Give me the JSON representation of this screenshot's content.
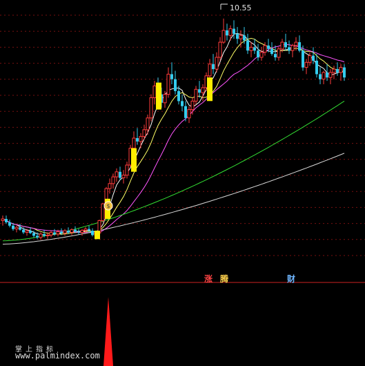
{
  "chart_data": {
    "type": "candlestick",
    "ylim": [
      3.0,
      11.0
    ],
    "peak_label": "10.55",
    "candles": [
      [
        4.55,
        4.7,
        4.4,
        4.6
      ],
      [
        4.6,
        4.7,
        4.45,
        4.5
      ],
      [
        4.5,
        4.58,
        4.35,
        4.4
      ],
      [
        4.4,
        4.48,
        4.25,
        4.3
      ],
      [
        4.3,
        4.4,
        4.2,
        4.35
      ],
      [
        4.35,
        4.45,
        4.25,
        4.28
      ],
      [
        4.28,
        4.35,
        4.15,
        4.2
      ],
      [
        4.2,
        4.3,
        4.1,
        4.25
      ],
      [
        4.25,
        4.35,
        4.15,
        4.18
      ],
      [
        4.18,
        4.25,
        4.05,
        4.1
      ],
      [
        4.1,
        4.2,
        4.0,
        4.05
      ],
      [
        4.05,
        4.2,
        3.98,
        4.15
      ],
      [
        4.15,
        4.28,
        4.05,
        4.1
      ],
      [
        4.1,
        4.2,
        4.0,
        4.12
      ],
      [
        4.12,
        4.25,
        4.05,
        4.2
      ],
      [
        4.2,
        4.3,
        4.1,
        4.15
      ],
      [
        4.15,
        4.28,
        4.08,
        4.22
      ],
      [
        4.22,
        4.32,
        4.12,
        4.18
      ],
      [
        4.18,
        4.3,
        4.1,
        4.25
      ],
      [
        4.25,
        4.35,
        4.15,
        4.2
      ],
      [
        4.2,
        4.32,
        4.12,
        4.28
      ],
      [
        4.28,
        4.38,
        4.18,
        4.22
      ],
      [
        4.22,
        4.3,
        4.14,
        4.2
      ],
      [
        4.2,
        4.3,
        4.1,
        4.26
      ],
      [
        4.26,
        4.36,
        4.18,
        4.3
      ],
      [
        4.3,
        4.4,
        4.2,
        4.25
      ],
      [
        4.25,
        4.32,
        4.08,
        4.12
      ],
      [
        4.12,
        4.22,
        4.02,
        4.18
      ],
      [
        4.18,
        4.58,
        4.12,
        4.55
      ],
      [
        4.55,
        5.08,
        4.5,
        5.05
      ],
      [
        5.05,
        5.55,
        5.0,
        5.5
      ],
      [
        5.5,
        5.8,
        5.35,
        5.65
      ],
      [
        5.65,
        5.95,
        5.5,
        5.85
      ],
      [
        5.85,
        6.1,
        5.7,
        6.0
      ],
      [
        6.0,
        6.15,
        5.75,
        5.82
      ],
      [
        5.82,
        6.05,
        5.65,
        5.9
      ],
      [
        5.9,
        6.3,
        5.8,
        6.2
      ],
      [
        6.2,
        6.8,
        6.15,
        6.7
      ],
      [
        6.7,
        7.2,
        6.55,
        7.0
      ],
      [
        7.0,
        7.3,
        6.8,
        6.9
      ],
      [
        6.9,
        7.15,
        6.7,
        7.05
      ],
      [
        7.05,
        7.4,
        6.95,
        7.25
      ],
      [
        7.25,
        7.7,
        7.1,
        7.6
      ],
      [
        7.6,
        8.3,
        7.5,
        8.2
      ],
      [
        8.2,
        8.7,
        8.0,
        8.55
      ],
      [
        8.55,
        8.8,
        8.2,
        8.3
      ],
      [
        8.3,
        8.5,
        7.9,
        8.05
      ],
      [
        8.05,
        8.4,
        7.9,
        8.3
      ],
      [
        8.3,
        9.1,
        8.2,
        8.9
      ],
      [
        8.9,
        9.25,
        8.6,
        8.75
      ],
      [
        8.75,
        9.0,
        8.3,
        8.4
      ],
      [
        8.4,
        8.55,
        8.0,
        8.1
      ],
      [
        8.1,
        8.3,
        7.8,
        7.95
      ],
      [
        7.95,
        8.1,
        7.5,
        7.6
      ],
      [
        7.6,
        7.95,
        7.45,
        7.85
      ],
      [
        7.85,
        8.2,
        7.7,
        8.1
      ],
      [
        8.1,
        8.55,
        8.0,
        8.45
      ],
      [
        8.45,
        8.7,
        8.2,
        8.35
      ],
      [
        8.35,
        8.6,
        8.1,
        8.5
      ],
      [
        8.5,
        8.95,
        8.4,
        8.85
      ],
      [
        8.85,
        9.35,
        8.7,
        9.2
      ],
      [
        9.2,
        9.5,
        8.9,
        9.05
      ],
      [
        9.05,
        9.55,
        8.95,
        9.4
      ],
      [
        9.4,
        10.0,
        9.3,
        9.85
      ],
      [
        9.85,
        10.55,
        9.8,
        10.2
      ],
      [
        10.2,
        10.4,
        9.9,
        10.05
      ],
      [
        10.05,
        10.35,
        9.9,
        10.25
      ],
      [
        10.25,
        10.5,
        9.95,
        10.1
      ],
      [
        10.1,
        10.3,
        9.8,
        9.95
      ],
      [
        9.95,
        10.2,
        9.7,
        10.05
      ],
      [
        10.05,
        10.3,
        9.8,
        9.9
      ],
      [
        9.9,
        10.1,
        9.5,
        9.6
      ],
      [
        9.6,
        9.85,
        9.4,
        9.7
      ],
      [
        9.7,
        9.95,
        9.5,
        9.6
      ],
      [
        9.6,
        9.8,
        9.3,
        9.4
      ],
      [
        9.4,
        9.7,
        9.3,
        9.55
      ],
      [
        9.55,
        9.85,
        9.45,
        9.75
      ],
      [
        9.75,
        9.95,
        9.55,
        9.65
      ],
      [
        9.65,
        9.85,
        9.45,
        9.5
      ],
      [
        9.5,
        9.75,
        9.3,
        9.4
      ],
      [
        9.4,
        9.7,
        9.3,
        9.65
      ],
      [
        9.65,
        9.95,
        9.55,
        9.85
      ],
      [
        9.85,
        10.1,
        9.6,
        9.7
      ],
      [
        9.7,
        9.9,
        9.5,
        9.6
      ],
      [
        9.6,
        9.8,
        9.4,
        9.75
      ],
      [
        9.75,
        10.0,
        9.6,
        9.85
      ],
      [
        9.85,
        10.05,
        9.55,
        9.6
      ],
      [
        9.6,
        9.75,
        9.0,
        9.1
      ],
      [
        9.1,
        9.35,
        8.9,
        9.25
      ],
      [
        9.25,
        9.55,
        9.15,
        9.45
      ],
      [
        9.45,
        9.7,
        9.2,
        9.3
      ],
      [
        9.3,
        9.5,
        8.8,
        8.9
      ],
      [
        8.9,
        9.1,
        8.6,
        8.75
      ],
      [
        8.75,
        9.0,
        8.6,
        8.95
      ],
      [
        8.95,
        9.2,
        8.7,
        8.8
      ],
      [
        8.8,
        9.05,
        8.6,
        8.95
      ],
      [
        8.95,
        9.15,
        8.75,
        9.05
      ],
      [
        9.05,
        9.25,
        8.85,
        8.95
      ],
      [
        8.95,
        9.2,
        8.7,
        9.1
      ],
      [
        9.1,
        9.2,
        8.7,
        8.8
      ]
    ],
    "highlight_bars": [
      {
        "x0": 137,
        "x1": 145,
        "y0": 4.25,
        "y1": 4.0
      },
      {
        "x0": 152,
        "x1": 160,
        "y0": 5.2,
        "y1": 4.6
      },
      {
        "x0": 190,
        "x1": 198,
        "y0": 6.7,
        "y1": 6.0
      },
      {
        "x0": 226,
        "x1": 234,
        "y0": 8.65,
        "y1": 7.85
      },
      {
        "x0": 300,
        "x1": 308,
        "y0": 8.8,
        "y1": 8.1
      }
    ],
    "signal_spike": {
      "x": 157,
      "base": 530,
      "top": 430
    },
    "signal_labels": [
      {
        "text": "涨",
        "color": "#ff4444"
      },
      {
        "text": "腾",
        "color": "#ffd24d"
      },
      {
        "text": "财",
        "color": "#6fb6ff"
      }
    ],
    "ma_colors": {
      "ma5": "#ffffff",
      "ma10": "#ffff66",
      "ma20": "#ff55ff",
      "ma60": "#33dd33",
      "ma120": "#d8d8d8"
    }
  },
  "watermark": {
    "line1": "掌上指标",
    "line2": "www.palmindex.com"
  }
}
